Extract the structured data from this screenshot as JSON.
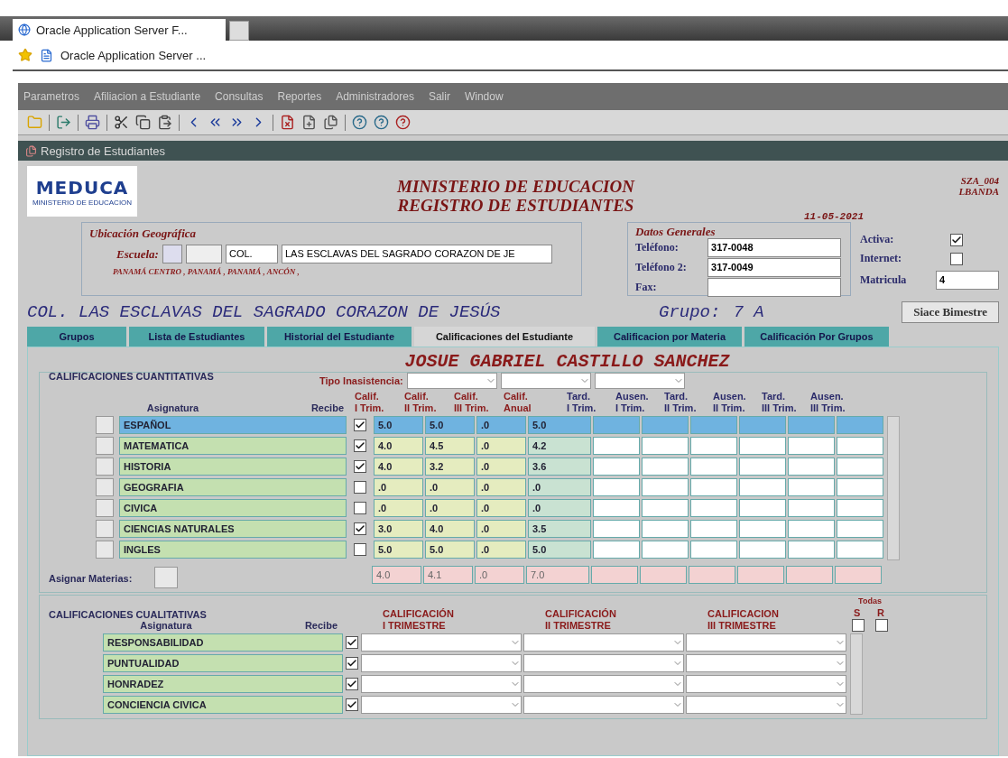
{
  "browser": {
    "tab_title": "Oracle Application Server F...",
    "bookmark": "Oracle Application Server ..."
  },
  "menu": [
    "Parametros",
    "Afiliacion a Estudiante",
    "Consultas",
    "Reportes",
    "Administradores",
    "Salir",
    "Window"
  ],
  "window_title": "Registro de Estudiantes",
  "header": {
    "logo": "MEDUCA",
    "logo_caption": "MINISTERIO DE EDUCACION",
    "title": "MINISTERIO DE EDUCACION",
    "subtitle": "REGISTRO DE ESTUDIANTES",
    "date": "11-05-2021",
    "code": "SZA_004",
    "user": "LBANDA"
  },
  "location": {
    "legend": "Ubicación Geográfica",
    "school_label": "Escuela:",
    "school_type": "COL.",
    "school_name": "LAS ESCLAVAS DEL SAGRADO CORAZON DE JE",
    "address": "PANAMÁ CENTRO , PANAMÁ , PANAMÁ , ANCÓN ,"
  },
  "general": {
    "legend": "Datos Generales",
    "phone_label": "Teléfono:",
    "phone": "317-0048",
    "phone2_label": "Teléfono 2:",
    "phone2": "317-0049",
    "fax_label": "Fax:",
    "active_label": "Activa:",
    "active": true,
    "internet_label": "Internet:",
    "internet": false,
    "enrollment_label": "Matricula",
    "enrollment": "4"
  },
  "banner": {
    "school": "COL. LAS ESCLAVAS DEL SAGRADO CORAZON DE JESÚS",
    "group_label": "Grupo:",
    "group": "7 A",
    "button": "Siace Bimestre"
  },
  "tabs": [
    {
      "label": "Grupos",
      "selected": false
    },
    {
      "label": "Lista de Estudiantes",
      "selected": false
    },
    {
      "label": "Historial del Estudiante",
      "selected": false
    },
    {
      "label": "Calificaciones del Estudiante",
      "selected": true
    },
    {
      "label": "Calificacion por Materia",
      "selected": false
    },
    {
      "label": "Calificación Por Grupos",
      "selected": false
    }
  ],
  "student_name": "JOSUE GABRIEL CASTILLO SANCHEZ",
  "quantitative": {
    "title": "CALIFICACIONES CUANTITATIVAS",
    "absence_label": "Tipo Inasistencia:",
    "subject_header": "Asignatura",
    "receives_header": "Recibe",
    "grade_headers": [
      "Calif.\nI Trim.",
      "Calif.\nII Trim.",
      "Calif.\nIII Trim.",
      "Calif.\nAnual"
    ],
    "absence_headers": [
      "Tard.\nI Trim.",
      "Ausen.\nI Trim.",
      "Tard.\nII Trim.",
      "Ausen.\nII Trim.",
      "Tard.\nIII Trim.",
      "Ausen.\nIII Trim."
    ],
    "rows": [
      {
        "subject": "ESPAÑOL",
        "receives": true,
        "selected": true,
        "grades": [
          "5.0",
          "5.0",
          ".0",
          "5.0"
        ]
      },
      {
        "subject": "MATEMATICA",
        "receives": true,
        "selected": false,
        "grades": [
          "4.0",
          "4.5",
          ".0",
          "4.2"
        ]
      },
      {
        "subject": "HISTORIA",
        "receives": true,
        "selected": false,
        "grades": [
          "4.0",
          "3.2",
          ".0",
          "3.6"
        ]
      },
      {
        "subject": "GEOGRAFIA",
        "receives": false,
        "selected": false,
        "grades": [
          ".0",
          ".0",
          ".0",
          ".0"
        ]
      },
      {
        "subject": "CIVICA",
        "receives": false,
        "selected": false,
        "grades": [
          ".0",
          ".0",
          ".0",
          ".0"
        ]
      },
      {
        "subject": "CIENCIAS NATURALES",
        "receives": true,
        "selected": false,
        "grades": [
          "3.0",
          "4.0",
          ".0",
          "3.5"
        ]
      },
      {
        "subject": "INGLES",
        "receives": false,
        "selected": false,
        "grades": [
          "5.0",
          "5.0",
          ".0",
          "5.0"
        ]
      }
    ],
    "totals": [
      "4.0",
      "4.1",
      ".0",
      "7.0"
    ],
    "assign_label": "Asignar Materias:"
  },
  "qualitative": {
    "title": "CALIFICACIONES CUALITATIVAS",
    "subject_header": "Asignatura",
    "receives_header": "Recibe",
    "term_headers": [
      "CALIFICACIÓN\nI TRIMESTRE",
      "CALIFICACIÓN\nII TRIMESTRE",
      "CALIFICACION\nIII TRIMESTRE"
    ],
    "all_label": "Todas",
    "s_label": "S",
    "r_label": "R",
    "s_checked": false,
    "r_checked": false,
    "rows": [
      {
        "subject": "RESPONSABILIDAD",
        "receives": true
      },
      {
        "subject": "PUNTUALIDAD",
        "receives": true
      },
      {
        "subject": "HONRADEZ",
        "receives": true
      },
      {
        "subject": "CONCIENCIA CIVICA",
        "receives": true
      }
    ]
  }
}
